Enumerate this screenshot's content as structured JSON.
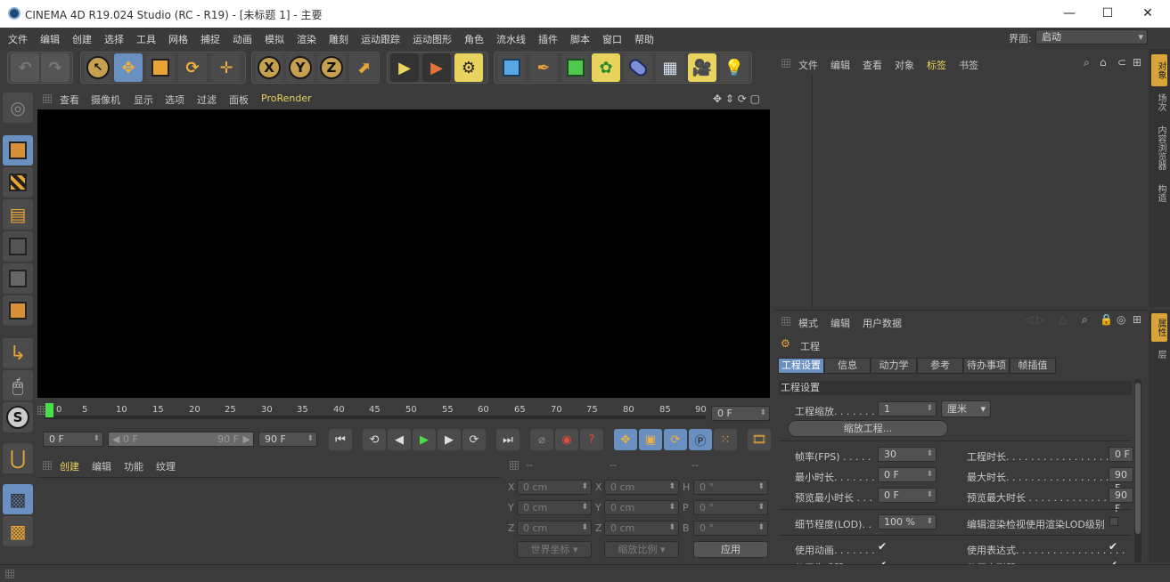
{
  "window": {
    "title": "CINEMA 4D R19.024 Studio (RC - R19) - [未标题 1] - 主要",
    "controls": [
      "—",
      "☐",
      "✕"
    ]
  },
  "menu": [
    "文件",
    "编辑",
    "创建",
    "选择",
    "工具",
    "网格",
    "捕捉",
    "动画",
    "模拟",
    "渲染",
    "雕刻",
    "运动跟踪",
    "运动图形",
    "角色",
    "流水线",
    "插件",
    "脚本",
    "窗口",
    "帮助"
  ],
  "interface": {
    "label": "界面:",
    "value": "启动"
  },
  "toolbar": {
    "axes": [
      "X",
      "Y",
      "Z"
    ]
  },
  "viewport": {
    "menu": [
      "查看",
      "摄像机",
      "显示",
      "选项",
      "过滤",
      "面板",
      "ProRender"
    ],
    "background": "#000000"
  },
  "timeline": {
    "ticks": [
      "0",
      "5",
      "10",
      "15",
      "20",
      "25",
      "30",
      "35",
      "40",
      "45",
      "50",
      "55",
      "60",
      "65",
      "70",
      "75",
      "80",
      "85",
      "90"
    ],
    "current": "0 F"
  },
  "playback": {
    "start": "0 F",
    "range_start": "0 F",
    "range_end": "90 F",
    "end": "90 F"
  },
  "material_panel": {
    "menu": [
      "创建",
      "编辑",
      "功能",
      "纹理"
    ]
  },
  "coord_panel": {
    "headers": [
      "--",
      "--",
      "--"
    ],
    "rows": [
      {
        "a": "X",
        "av": "0 cm",
        "b": "X",
        "bv": "0 cm",
        "c": "H",
        "cv": "0 °"
      },
      {
        "a": "Y",
        "av": "0 cm",
        "b": "Y",
        "bv": "0 cm",
        "c": "P",
        "cv": "0 °"
      },
      {
        "a": "Z",
        "av": "0 cm",
        "b": "Z",
        "bv": "0 cm",
        "c": "B",
        "cv": "0 °"
      }
    ],
    "world": "世界坐标",
    "scale": "缩放比例",
    "apply": "应用"
  },
  "object_manager": {
    "menu": [
      "文件",
      "编辑",
      "查看",
      "对象",
      "标签",
      "书签"
    ]
  },
  "right_tabs_top": [
    "对象",
    "场次",
    "内容浏览器",
    "构造"
  ],
  "right_tabs_bottom": [
    "属性",
    "层"
  ],
  "attributes": {
    "menu": [
      "模式",
      "编辑",
      "用户数据"
    ],
    "title": "工程",
    "tabs": [
      "工程设置",
      "信息",
      "动力学",
      "参考",
      "待办事项",
      "帧插值"
    ],
    "section": "工程设置",
    "project_scale_label": "工程缩放. . . . . . .",
    "project_scale_value": "1",
    "project_scale_unit": "厘米",
    "scale_button": "缩放工程...",
    "fps_label": "帧率(FPS) . . . . .",
    "fps_value": "30",
    "duration_label": "工程时长. . . . . . . . . . . . . . . . . . . .",
    "duration_value": "0 F",
    "min_time_label": "最小时长. . . . . . .",
    "min_time_value": "0 F",
    "max_time_label": "最大时长. . . . . . . . . . . . . . . . . . . .",
    "max_time_value": "90 F",
    "preview_min_label": "预览最小时长 . . .",
    "preview_min_value": "0 F",
    "preview_max_label": "预览最大时长 . . . . . . . . . . . . . . . .",
    "preview_max_value": "90 F",
    "lod_label": "细节程度(LOD). .",
    "lod_value": "100 %",
    "lod_render_label": "编辑渲染检视使用渲染LOD级别",
    "use_anim_label": "使用动画. . . . . . .",
    "use_expr_label": "使用表达式. . . . . . . . . . . . . . . . . .",
    "use_gen_label": "使用生成器",
    "use_deform_label": "使用变形器"
  }
}
